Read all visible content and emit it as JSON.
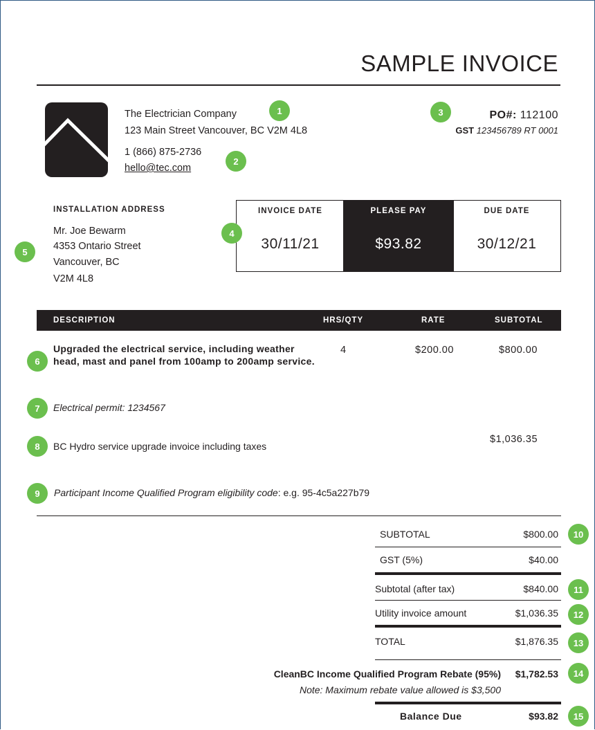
{
  "title": "SAMPLE INVOICE",
  "company": {
    "name": "The Electrician Company",
    "address": "123 Main Street Vancouver, BC V2M 4L8",
    "phone": "1 (866) 875-2736",
    "email": "hello@tec.com"
  },
  "po": {
    "label": "PO#:",
    "number": "112100"
  },
  "gst": {
    "label": "GST",
    "number": "123456789 RT 0001"
  },
  "installation": {
    "heading": "INSTALLATION ADDRESS",
    "lines": [
      "Mr. Joe Bewarm",
      "4353 Ontario Street",
      "Vancouver, BC",
      "V2M 4L8"
    ]
  },
  "dates": {
    "invoice_label": "INVOICE DATE",
    "invoice_date": "30/11/21",
    "pay_label": "PLEASE PAY",
    "pay_amount": "$93.82",
    "due_label": "DUE DATE",
    "due_date": "30/12/21"
  },
  "table": {
    "headers": [
      "DESCRIPTION",
      "HRS/QTY",
      "RATE",
      "SUBTOTAL"
    ],
    "item1": {
      "description": "Upgraded the electrical service, including weather head, mast and panel from 100amp to 200amp service.",
      "qty": "4",
      "rate": "$200.00",
      "subtotal": "$800.00"
    },
    "permit": "Electrical permit: 1234567",
    "hydro": {
      "description": "BC Hydro service upgrade invoice including taxes",
      "amount": "$1,036.35"
    },
    "eligibility": {
      "label": "Participant Income Qualified Program eligibility code",
      "value": ": e.g. 95-4c5a227b79"
    }
  },
  "totals": {
    "subtotal_label": "SUBTOTAL",
    "subtotal": "$800.00",
    "gst_label": "GST (5%)",
    "gst": "$40.00",
    "after_tax_label": "Subtotal (after tax)",
    "after_tax": "$840.00",
    "utility_label": "Utility invoice amount",
    "utility": "$1,036.35",
    "total_label": "TOTAL",
    "total": "$1,876.35",
    "rebate_label": "CleanBC Income Qualified Program Rebate (95%)",
    "rebate": "$1,782.53",
    "rebate_note": "Note: Maximum rebate value allowed is $3,500",
    "balance_label": "Balance Due",
    "balance": "$93.82"
  },
  "badges": [
    "1",
    "2",
    "3",
    "4",
    "5",
    "6",
    "7",
    "8",
    "9",
    "10",
    "11",
    "12",
    "13",
    "14",
    "15"
  ],
  "colors": {
    "badge": "#6bbf4e",
    "ink": "#231f20",
    "frame": "#2f5a84"
  }
}
